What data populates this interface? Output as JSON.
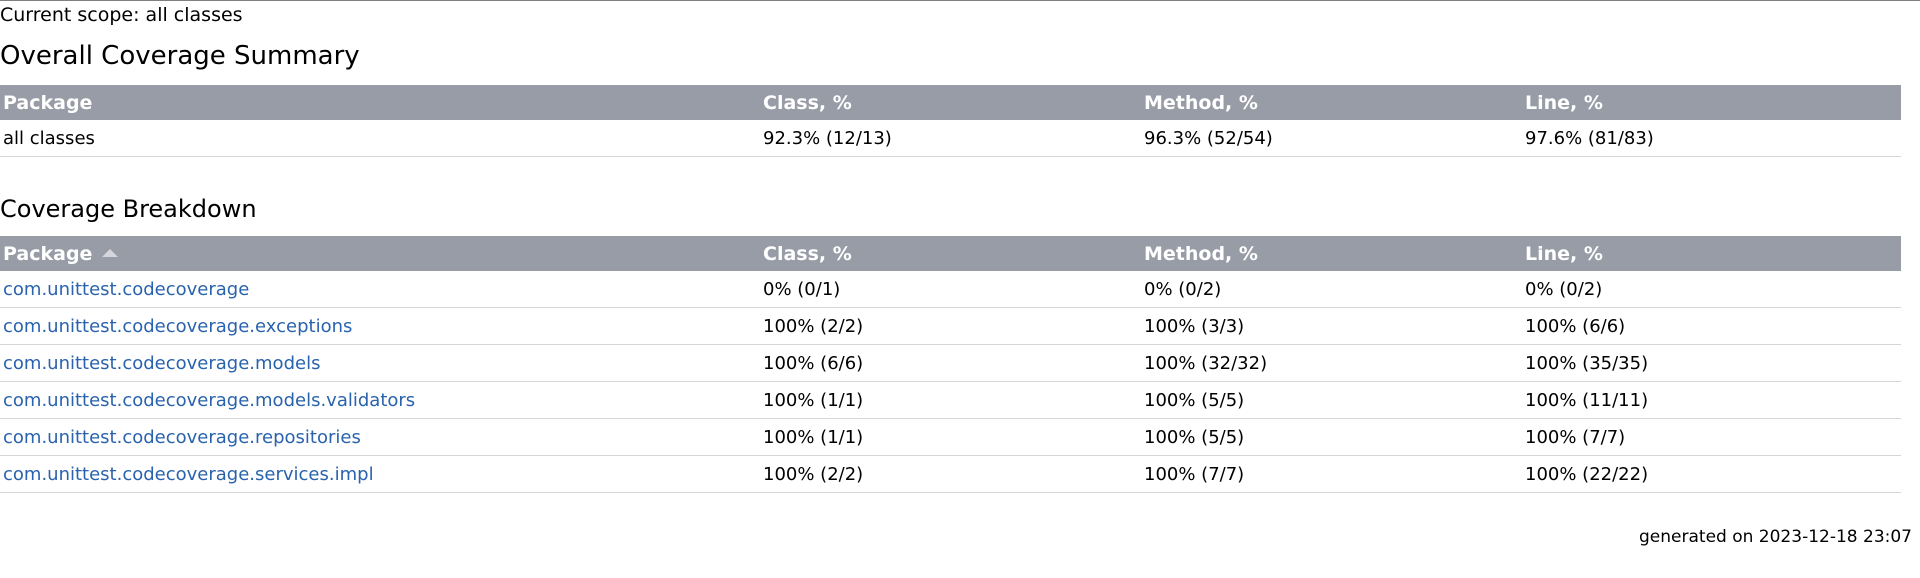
{
  "scope": "Current scope: all classes",
  "summary": {
    "title": "Overall Coverage Summary",
    "headers": [
      "Package",
      "Class, %",
      "Method, %",
      "Line, %"
    ],
    "row": {
      "package": "all classes",
      "class": "92.3% (12/13)",
      "method": "96.3% (52/54)",
      "line": "97.6% (81/83)"
    }
  },
  "breakdown": {
    "title": "Coverage Breakdown",
    "headers": [
      "Package",
      "Class, %",
      "Method, %",
      "Line, %"
    ],
    "sort_icon": "sort-ascending-icon",
    "rows": [
      {
        "package": "com.unittest.codecoverage",
        "class": "0% (0/1)",
        "method": "0% (0/2)",
        "line": "0% (0/2)"
      },
      {
        "package": "com.unittest.codecoverage.exceptions",
        "class": "100% (2/2)",
        "method": "100% (3/3)",
        "line": "100% (6/6)"
      },
      {
        "package": "com.unittest.codecoverage.models",
        "class": "100% (6/6)",
        "method": "100% (32/32)",
        "line": "100% (35/35)"
      },
      {
        "package": "com.unittest.codecoverage.models.validators",
        "class": "100% (1/1)",
        "method": "100% (5/5)",
        "line": "100% (11/11)"
      },
      {
        "package": "com.unittest.codecoverage.repositories",
        "class": "100% (1/1)",
        "method": "100% (5/5)",
        "line": "100% (7/7)"
      },
      {
        "package": "com.unittest.codecoverage.services.impl",
        "class": "100% (2/2)",
        "method": "100% (7/7)",
        "line": "100% (22/22)"
      }
    ]
  },
  "footer": "generated on 2023-12-18 23:07",
  "colors": {
    "header_bg": "#989ca6",
    "link": "#2962ad",
    "row_border": "#d6d6d6"
  }
}
